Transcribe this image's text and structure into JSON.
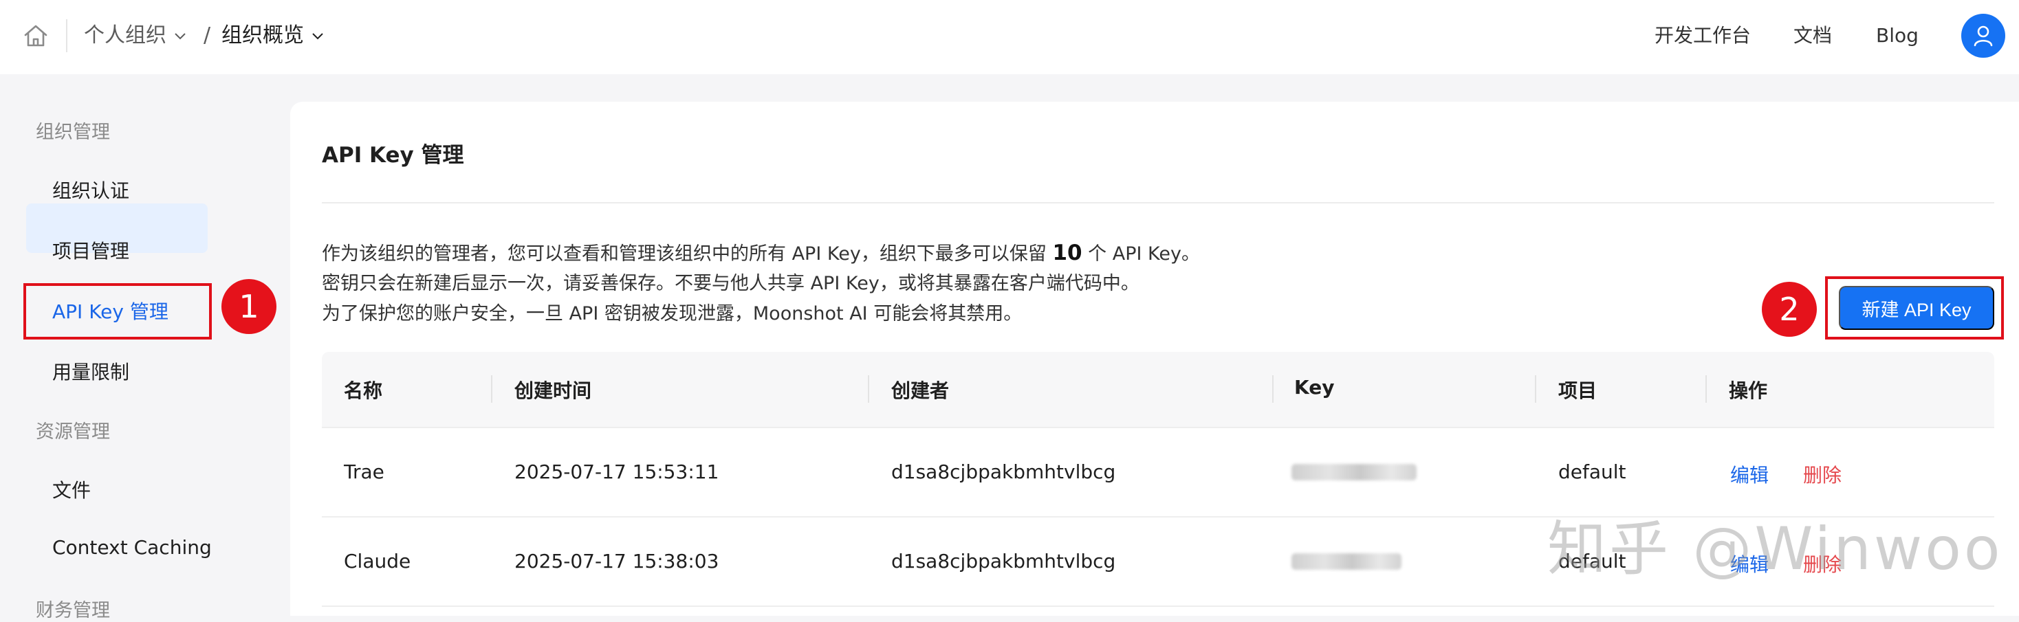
{
  "breadcrumb": {
    "org": "个人组织",
    "separator": "/",
    "page": "组织概览"
  },
  "topnav": {
    "console": "开发工作台",
    "docs": "文档",
    "blog": "Blog"
  },
  "icons": {
    "home": "home-icon",
    "avatar": "user-icon",
    "chevron": "chevron-down-icon"
  },
  "sidebar": {
    "groups": [
      {
        "label": "组织管理",
        "items": [
          "组织认证",
          "项目管理",
          "API Key 管理",
          "用量限制"
        ]
      },
      {
        "label": "资源管理",
        "items": [
          "文件",
          "Context Caching"
        ]
      },
      {
        "label": "财务管理",
        "items": []
      }
    ],
    "active_item": "API Key 管理"
  },
  "annotations": {
    "step1": "1",
    "step2": "2",
    "highlight_color": "#e0101a"
  },
  "main": {
    "title": "API Key 管理",
    "desc": {
      "line1_prefix": "作为该组织的管理者，您可以查看和管理该组织中的所有 API Key，组织下最多可以保留",
      "line1_count": "10",
      "line1_suffix": "个 API Key。",
      "line2": "密钥只会在新建后显示一次，请妥善保存。不要与他人共享 API Key，或将其暴露在客户端代码中。",
      "line3": "为了保护您的账户安全，一旦 API 密钥被发现泄露，Moonshot AI 可能会将其禁用。"
    },
    "new_button": "新建 API Key",
    "table": {
      "headers": [
        "名称",
        "创建时间",
        "创建者",
        "Key",
        "项目",
        "操作"
      ],
      "rows": [
        {
          "name": "Trae",
          "created_at": "2025-07-17 15:53:11",
          "creator": "d1sa8cjbpakbmhtvlbcg",
          "key": "",
          "project": "default",
          "edit": "编辑",
          "delete": "删除"
        },
        {
          "name": "Claude",
          "created_at": "2025-07-17 15:38:03",
          "creator": "d1sa8cjbpakbmhtvlbcg",
          "key": "",
          "project": "default",
          "edit": "编辑",
          "delete": "删除"
        }
      ]
    }
  },
  "watermark": "知乎 @Winwoo",
  "colors": {
    "primary": "#1672f3",
    "link": "#1a66e8",
    "danger": "#e5484d",
    "active_bg": "#e6f0ff"
  }
}
